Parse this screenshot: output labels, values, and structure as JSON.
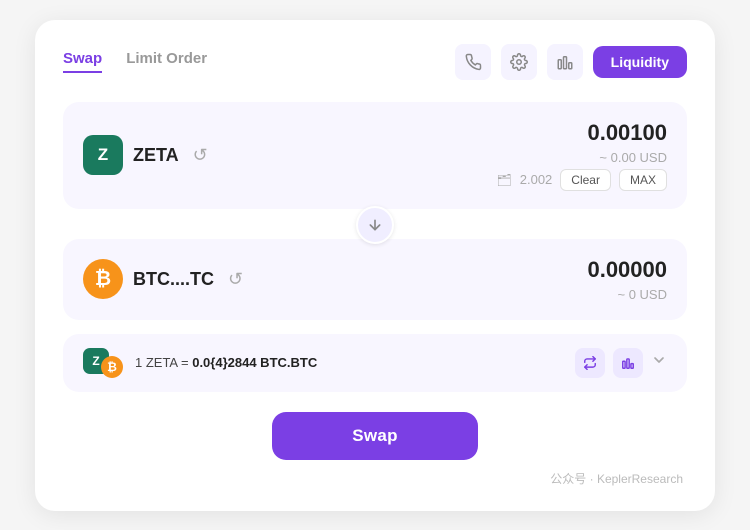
{
  "tabs": [
    {
      "label": "Swap",
      "active": true
    },
    {
      "label": "Limit Order",
      "active": false
    }
  ],
  "header": {
    "liquidity_label": "Liquidity"
  },
  "from_token": {
    "symbol": "ZETA",
    "icon_letter": "Z",
    "amount": "0.00100",
    "usd_value": "~ 0.00 USD",
    "balance": "2.002",
    "clear_label": "Clear",
    "max_label": "MAX"
  },
  "to_token": {
    "symbol": "BTC....TC",
    "icon_char": "₿",
    "amount": "0.00000",
    "usd_value": "~ 0 USD"
  },
  "rate": {
    "from": "1 ZETA",
    "equals": " = ",
    "rate_value": "0.0{4}2844",
    "rate_suffix": " BTC.BTC"
  },
  "swap_button": {
    "label": "Swap"
  },
  "watermark": "公众号 · KeplerResearch"
}
